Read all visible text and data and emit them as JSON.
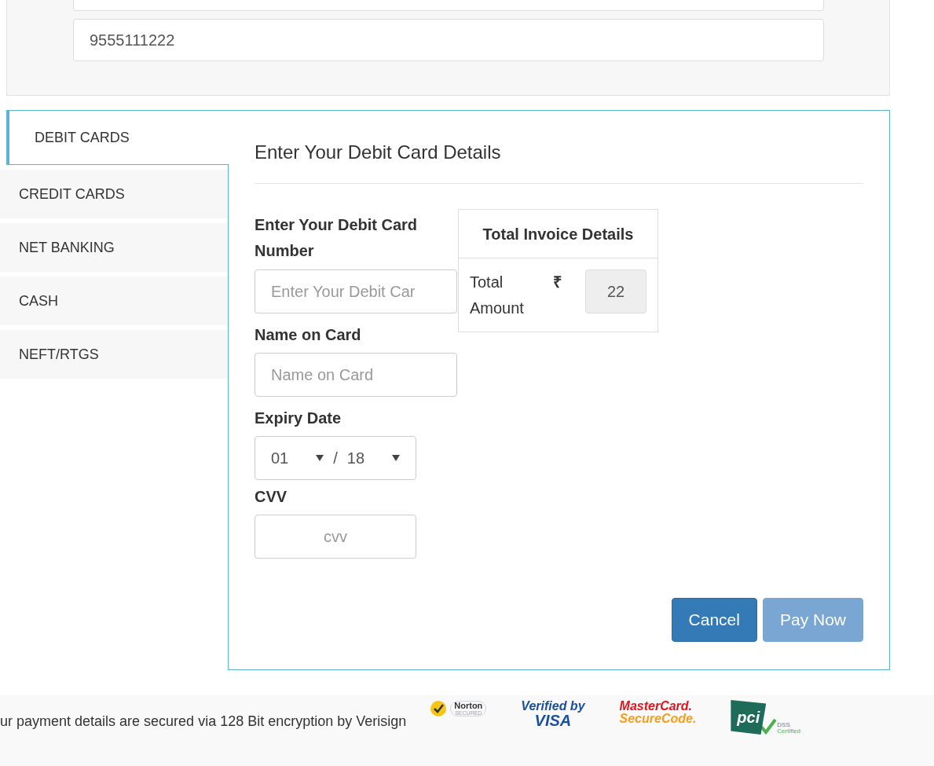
{
  "contact": {
    "phone": "9555111222"
  },
  "tabs": [
    {
      "label": "DEBIT CARDS",
      "selected": true
    },
    {
      "label": "CREDIT CARDS",
      "selected": false
    },
    {
      "label": "NET BANKING",
      "selected": false
    },
    {
      "label": "CASH",
      "selected": false
    },
    {
      "label": "NEFT/RTGS",
      "selected": false
    }
  ],
  "form": {
    "title": "Enter Your Debit Card Details",
    "card_number": {
      "label": "Enter Your Debit Card Number",
      "placeholder": "Enter Your Debit Car"
    },
    "name": {
      "label": "Name on Card",
      "placeholder": "Name on Card"
    },
    "expiry": {
      "label": "Expiry Date",
      "month": "01",
      "separator": "/",
      "year": "18"
    },
    "cvv": {
      "label": "CVV",
      "placeholder": "cvv"
    }
  },
  "invoice": {
    "title": "Total Invoice Details",
    "label": "Total Amount",
    "currency": "₹",
    "amount": "22"
  },
  "buttons": [
    {
      "label": "Cancel",
      "disabled": false
    },
    {
      "label": "Pay Now",
      "disabled": true
    }
  ],
  "footer": {
    "text": "ur payment details are secured via 128 Bit encryption by Verisign",
    "logos": [
      {
        "kind": "norton",
        "lines": [
          "Norton",
          "SECURED"
        ]
      },
      {
        "kind": "visa",
        "lines": [
          "Verified by",
          "VISA"
        ]
      },
      {
        "kind": "mastercard",
        "lines": [
          "MasterCard.",
          "SecureCode."
        ]
      },
      {
        "kind": "pci",
        "lines": [
          "pci",
          "DSS",
          "Certified"
        ]
      }
    ]
  }
}
